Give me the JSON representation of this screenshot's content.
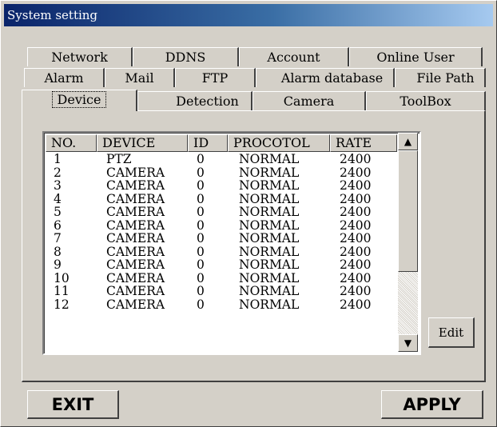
{
  "window": {
    "title": "System setting"
  },
  "tabs": {
    "row1": [
      "Network",
      "DDNS",
      "Account",
      "Online User"
    ],
    "row2": [
      "Alarm",
      "Mail",
      "FTP",
      "Alarm database",
      "File Path"
    ],
    "row3": [
      "Device",
      "Detection",
      "Camera",
      "ToolBox"
    ],
    "active": "Device"
  },
  "table": {
    "headers": [
      "NO.",
      "DEVICE",
      "ID",
      "PROCOTOL",
      "RATE"
    ],
    "rows": [
      [
        "1",
        "PTZ",
        "0",
        "NORMAL",
        "2400"
      ],
      [
        "2",
        "CAMERA",
        "0",
        "NORMAL",
        "2400"
      ],
      [
        "3",
        "CAMERA",
        "0",
        "NORMAL",
        "2400"
      ],
      [
        "4",
        "CAMERA",
        "0",
        "NORMAL",
        "2400"
      ],
      [
        "5",
        "CAMERA",
        "0",
        "NORMAL",
        "2400"
      ],
      [
        "6",
        "CAMERA",
        "0",
        "NORMAL",
        "2400"
      ],
      [
        "7",
        "CAMERA",
        "0",
        "NORMAL",
        "2400"
      ],
      [
        "8",
        "CAMERA",
        "0",
        "NORMAL",
        "2400"
      ],
      [
        "9",
        "CAMERA",
        "0",
        "NORMAL",
        "2400"
      ],
      [
        "10",
        "CAMERA",
        "0",
        "NORMAL",
        "2400"
      ],
      [
        "11",
        "CAMERA",
        "0",
        "NORMAL",
        "2400"
      ],
      [
        "12",
        "CAMERA",
        "0",
        "NORMAL",
        "2400"
      ]
    ]
  },
  "buttons": {
    "edit": "Edit",
    "exit": "EXIT",
    "apply": "APPLY"
  },
  "icons": {
    "scroll_up": "arrow-up-icon",
    "scroll_down": "arrow-down-icon"
  }
}
